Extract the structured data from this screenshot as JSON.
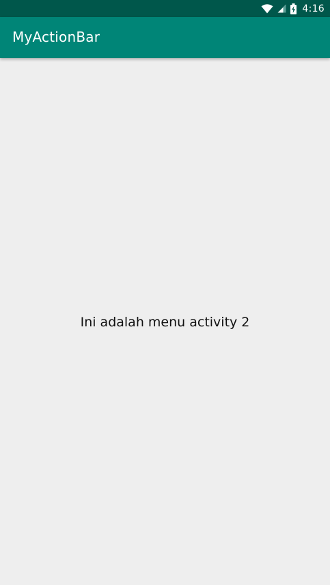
{
  "status_bar": {
    "time": "4:16",
    "icons": [
      "wifi-icon",
      "cell-signal-icon",
      "battery-charging-icon"
    ]
  },
  "app_bar": {
    "title": "MyActionBar"
  },
  "content": {
    "message": "Ini adalah menu activity 2"
  },
  "colors": {
    "status_bar": "#00574b",
    "app_bar": "#008577",
    "background": "#eeeeee"
  }
}
